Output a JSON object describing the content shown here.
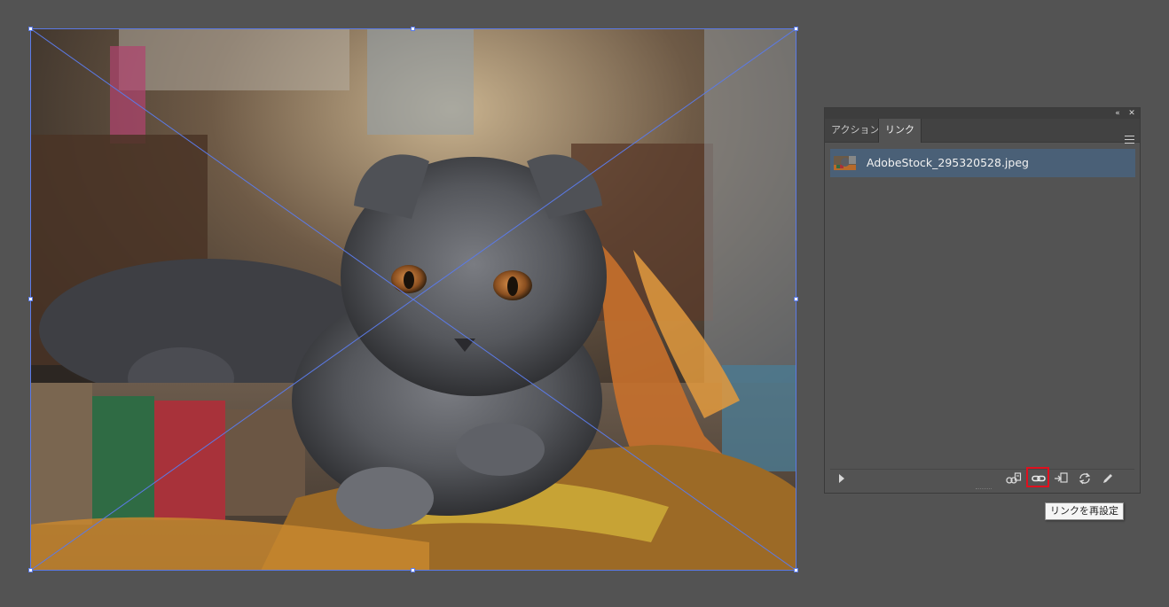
{
  "document": {
    "placed_image": {
      "subject": "kitten-on-knitted-blanket",
      "state": "selected"
    }
  },
  "panel": {
    "tabs": [
      {
        "label": "アクション",
        "active": false
      },
      {
        "label": "リンク",
        "active": true
      }
    ],
    "titlebar": {
      "collapse_icon": "double-chevron-left-icon",
      "close_icon": "close-icon"
    },
    "menu_icon": "panel-menu-icon",
    "links": [
      {
        "filename": "AdobeStock_295320528.jpeg",
        "selected": true
      }
    ],
    "footer": {
      "buttons": [
        {
          "name": "cc-library-link-icon"
        },
        {
          "name": "relink-icon",
          "highlighted": true
        },
        {
          "name": "go-to-link-icon"
        },
        {
          "name": "update-link-icon"
        },
        {
          "name": "edit-original-icon"
        }
      ]
    }
  },
  "tooltip": {
    "text": "リンクを再設定"
  },
  "colors": {
    "workspace": "#535353",
    "selection": "#5b7ae6",
    "row_selected": "#4a6077",
    "highlight": "#e0101e"
  }
}
